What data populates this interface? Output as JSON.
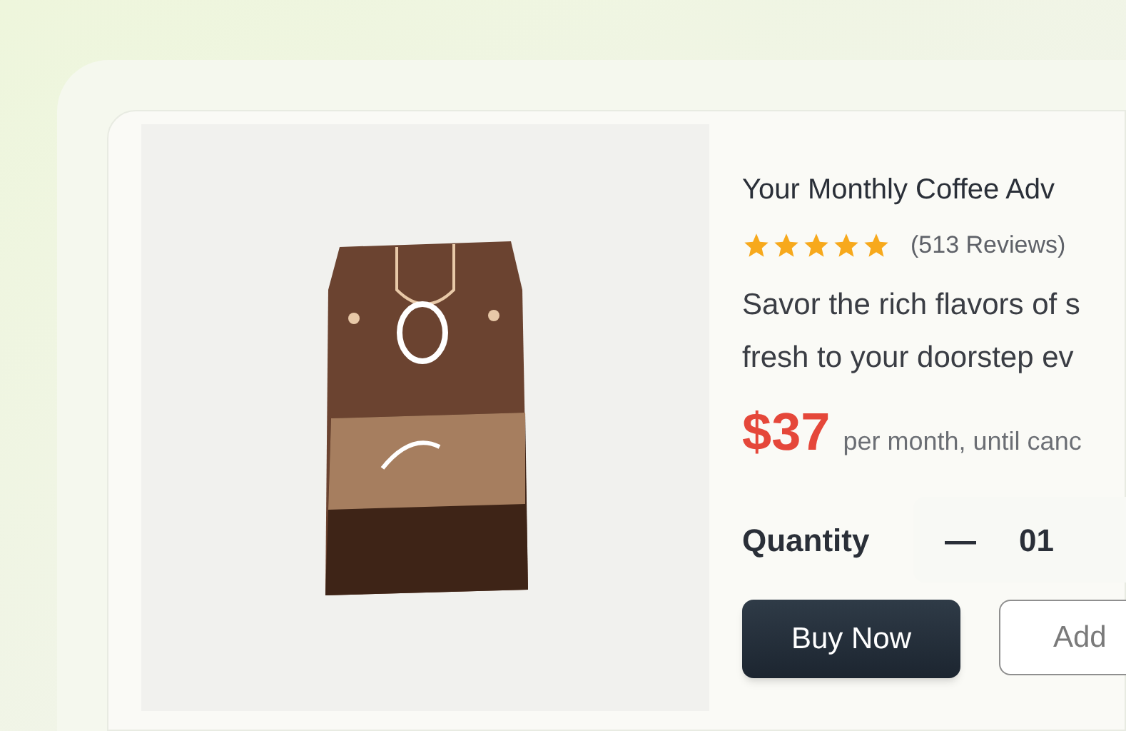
{
  "product": {
    "title": "Your Monthly Coffee Adv",
    "rating": {
      "stars": 5,
      "reviews": "(513 Reviews)"
    },
    "description": [
      "Savor the rich flavors of s",
      "fresh to your doorstep ev"
    ],
    "price": "$37",
    "price_note": "per month, until canc",
    "quantity": {
      "label": "Quantity",
      "decrement": "—",
      "value": "01"
    },
    "buttons": [
      {
        "label": "Buy Now",
        "kind": "primary"
      },
      {
        "label": "Add",
        "kind": "outline"
      }
    ]
  }
}
